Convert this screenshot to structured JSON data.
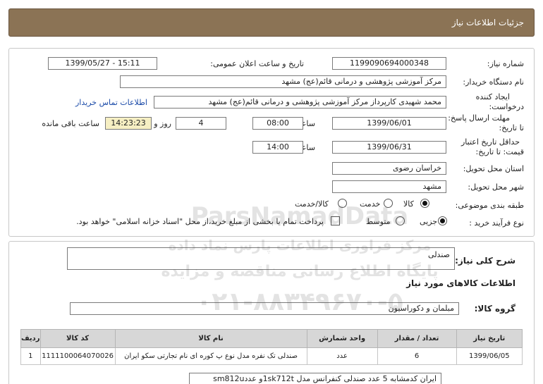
{
  "header": {
    "title": "جزئیات اطلاعات نیاز"
  },
  "labels": {
    "need_number": "شماره نیاز:",
    "announce_datetime": "تاریخ و ساعت اعلان عمومی:",
    "buyer_org": "نام دستگاه خریدار:",
    "requester_1": "ایجاد کننده",
    "requester_2": "درخواست:",
    "deadline_1": "مهلت ارسال پاسخ:",
    "deadline_2": "تا تاریخ:",
    "time": "ساعت",
    "day_and": "روز و",
    "remaining": "ساعت باقی مانده",
    "validity_1": "حداقل تاریخ اعتبار",
    "validity_2": "قیمت: تا تاریخ:",
    "province": "استان محل تحویل:",
    "city": "شهر محل تحویل:",
    "category": "طبقه بندی موضوعی:",
    "purchase_type": "نوع فرآیند خرید :"
  },
  "fields": {
    "need_number": "1199090694000348",
    "announce_datetime": "1399/05/27 - 15:11",
    "buyer_org": "مرکز آموزشی پژوهشی و درمانی قائم(عج) مشهد",
    "requester": "محمد شهیدی کارپرداز مرکز آموزشی پژوهشی و درمانی قائم(عج) مشهد",
    "contact_link": "اطلاعات تماس خریدار",
    "deadline_date": "1399/06/01",
    "deadline_time": "08:00",
    "days": "4",
    "remaining_time": "14:23:23",
    "validity_date": "1399/06/31",
    "validity_time": "14:00",
    "province": "خراسان رضوی",
    "city": "مشهد"
  },
  "category_options": [
    {
      "label": "کالا",
      "selected": true
    },
    {
      "label": "خدمت",
      "selected": false
    },
    {
      "label": "کالا/خدمت",
      "selected": false
    }
  ],
  "purchase_options": [
    {
      "label": "جزیی",
      "selected": true
    },
    {
      "label": "متوسط",
      "selected": false
    }
  ],
  "payment_note": "پرداخت تمام یا بخشی از مبلغ خرید،از محل \"اسناد خزانه اسلامی\" خواهد بود.",
  "general_desc": {
    "label": "شرح کلی نیاز:",
    "value": "صندلی"
  },
  "goods_info_title": "اطلاعات کالاهای مورد نیاز",
  "goods_group": {
    "label": "گروه کالا:",
    "value": "مبلمان و دکوراسیون"
  },
  "table": {
    "headers": [
      "ردیف",
      "کد کالا",
      "نام کالا",
      "واحد شمارش",
      "تعداد / مقدار",
      "تاریخ نیاز"
    ],
    "rows": [
      [
        "1",
        "1111100064070026",
        "صندلی تک نفره مدل نوع پ کوره ای نام تجارتی سکو ایران",
        "عدد",
        "6",
        "1399/06/05"
      ]
    ]
  },
  "note": "ایران کدمشابه 5 عدد صندلی کنفرانس مدل 1sk712tو عددsm812u",
  "watermark": {
    "brand": "ParsNamadData",
    "line1": "مرکز فراوری اطلاعات پارس نماد داده",
    "line2": "پایگاه اطلاع رسانی مناقصه و مزایده",
    "phone": "۰۲۱-۸۸۳۴۹۶۷۰-۵"
  }
}
